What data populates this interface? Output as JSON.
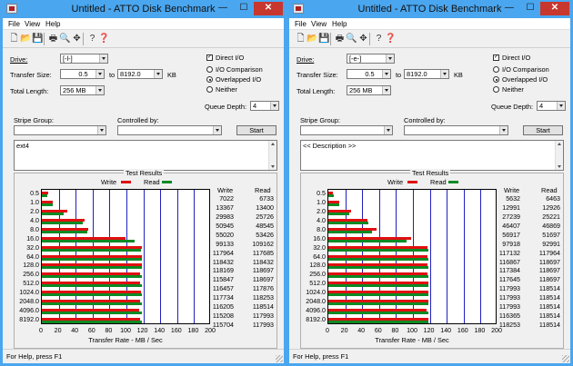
{
  "windows": [
    {
      "title": "Untitled - ATTO Disk Benchmark",
      "controls": {
        "minimize": "—",
        "maximize": "☐",
        "close": "✕"
      },
      "menu": [
        "File",
        "View",
        "Help"
      ],
      "toolbar": {
        "icons": [
          "new-doc-icon",
          "open-folder-icon",
          "save-icon",
          "print-icon",
          "print-preview-icon",
          "move-icon",
          "help-icon",
          "context-help-icon"
        ]
      },
      "drive_label": "Drive:",
      "drive_value": "[-l-]",
      "transfer_size_label": "Transfer Size:",
      "transfer_from": "0.5",
      "transfer_to_label": "to",
      "transfer_to": "8192.0",
      "transfer_unit": "KB",
      "total_length_label": "Total Length:",
      "total_length": "256 MB",
      "direct_io_label": "Direct I/O",
      "direct_io_checked": true,
      "io_comparison_label": "I/O Comparison",
      "overlapped_io_label": "Overlapped I/O",
      "neither_label": "Neither",
      "io_mode_selected": "overlapped",
      "queue_depth_label": "Queue Depth:",
      "queue_depth": "4",
      "stripe_group_label": "Stripe Group:",
      "controlled_by_label": "Controlled by:",
      "start_label": "Start",
      "description": "ext4",
      "results_title": "Test Results",
      "legend_write": "Write",
      "legend_read": "Read",
      "col_write": "Write",
      "col_read": "Read",
      "x_axis_label": "Transfer Rate - MB / Sec",
      "status": "For Help, press F1",
      "chart_data": {
        "type": "bar",
        "categories": [
          "0.5",
          "1.0",
          "2.0",
          "4.0",
          "8.0",
          "16.0",
          "32.0",
          "64.0",
          "128.0",
          "256.0",
          "512.0",
          "1024.0",
          "2048.0",
          "4096.0",
          "8192.0"
        ],
        "x_ticks": [
          "0",
          "20",
          "40",
          "60",
          "80",
          "100",
          "120",
          "140",
          "160",
          "180",
          "200"
        ],
        "xlim": [
          0,
          200
        ],
        "xlabel": "Transfer Rate - MB / Sec",
        "series": [
          {
            "name": "Write",
            "color": "#e01010",
            "values": [
              7022,
              13367,
              29983,
              50945,
              55020,
              99133,
              117964,
              118432,
              118169,
              115847,
              116457,
              117734,
              116205,
              115208,
              115704
            ]
          },
          {
            "name": "Read",
            "color": "#0c8a24",
            "values": [
              6733,
              13400,
              25726,
              48545,
              53426,
              109162,
              117685,
              118432,
              118697,
              118697,
              117876,
              118253,
              118514,
              117993,
              117993
            ]
          }
        ]
      }
    },
    {
      "title": "Untitled - ATTO Disk Benchmark",
      "controls": {
        "minimize": "—",
        "maximize": "☐",
        "close": "✕"
      },
      "menu": [
        "File",
        "View",
        "Help"
      ],
      "toolbar": {
        "icons": [
          "new-doc-icon",
          "open-folder-icon",
          "save-icon",
          "print-icon",
          "print-preview-icon",
          "move-icon",
          "help-icon",
          "context-help-icon"
        ]
      },
      "drive_label": "Drive:",
      "drive_value": "[-e-]",
      "transfer_size_label": "Transfer Size:",
      "transfer_from": "0.5",
      "transfer_to_label": "to",
      "transfer_to": "8192.0",
      "transfer_unit": "KB",
      "total_length_label": "Total Length:",
      "total_length": "256 MB",
      "direct_io_label": "Direct I/O",
      "direct_io_checked": true,
      "io_comparison_label": "I/O Comparison",
      "overlapped_io_label": "Overlapped I/O",
      "neither_label": "Neither",
      "io_mode_selected": "overlapped",
      "queue_depth_label": "Queue Depth:",
      "queue_depth": "4",
      "stripe_group_label": "Stripe Group:",
      "controlled_by_label": "Controlled by:",
      "start_label": "Start",
      "description": "<< Description >>",
      "results_title": "Test Results",
      "legend_write": "Write",
      "legend_read": "Read",
      "col_write": "Write",
      "col_read": "Read",
      "x_axis_label": "Transfer Rate - MB / Sec",
      "status": "For Help, press F1",
      "chart_data": {
        "type": "bar",
        "categories": [
          "0.5",
          "1.0",
          "2.0",
          "4.0",
          "8.0",
          "16.0",
          "32.0",
          "64.0",
          "128.0",
          "256.0",
          "512.0",
          "1024.0",
          "2048.0",
          "4096.0",
          "8192.0"
        ],
        "x_ticks": [
          "0",
          "20",
          "40",
          "60",
          "80",
          "100",
          "120",
          "140",
          "160",
          "180",
          "200"
        ],
        "xlim": [
          0,
          200
        ],
        "xlabel": "Transfer Rate - MB / Sec",
        "series": [
          {
            "name": "Write",
            "color": "#e01010",
            "values": [
              5632,
              12991,
              27239,
              46407,
              56917,
              97918,
              117132,
              116867,
              117384,
              117645,
              117993,
              117993,
              117993,
              116365,
              118253
            ]
          },
          {
            "name": "Read",
            "color": "#0c8a24",
            "values": [
              6463,
              12926,
              25221,
              46869,
              51697,
              92991,
              117964,
              118697,
              118697,
              118697,
              118514,
              118514,
              118514,
              118514,
              118514
            ]
          }
        ]
      }
    }
  ]
}
